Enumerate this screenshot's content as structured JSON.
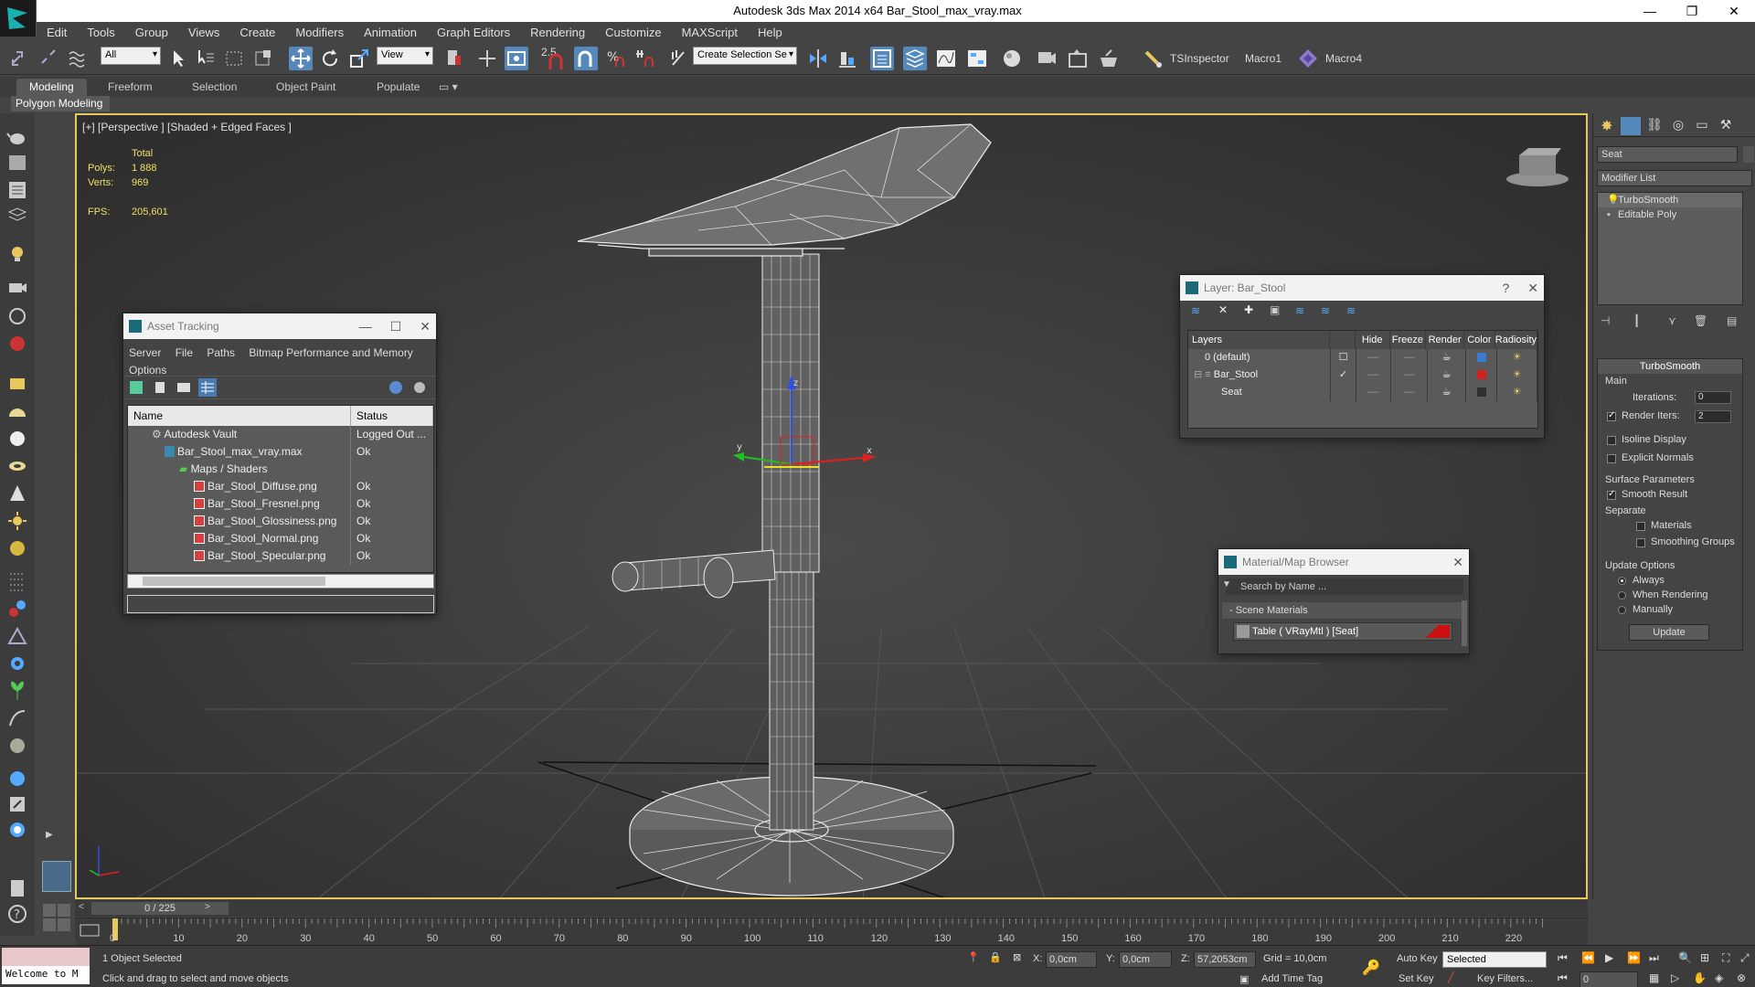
{
  "window": {
    "title": "Autodesk 3ds Max  2014 x64     Bar_Stool_max_vray.max"
  },
  "menu": [
    "Edit",
    "Tools",
    "Group",
    "Views",
    "Create",
    "Modifiers",
    "Animation",
    "Graph Editors",
    "Rendering",
    "Customize",
    "MAXScript",
    "Help"
  ],
  "toolbar": {
    "filter": "All",
    "refcoord": "View",
    "snap_value": "2.5",
    "selection_set": "Create Selection Se",
    "ts_inspector": "TSInspector",
    "macro1": "Macro1",
    "macro4": "Macro4"
  },
  "ribbon": {
    "tabs": [
      "Modeling",
      "Freeform",
      "Selection",
      "Object Paint",
      "Populate"
    ],
    "panel": "Polygon Modeling"
  },
  "viewport": {
    "label": "[+] [Perspective ] [Shaded + Edged Faces ]",
    "stats": {
      "total_label": "Total",
      "polys_label": "Polys:",
      "polys": "1 888",
      "verts_label": "Verts:",
      "verts": "969",
      "fps_label": "FPS:",
      "fps": "205,601"
    },
    "axes": {
      "x": "x",
      "y": "y",
      "z": "z"
    }
  },
  "asset_tracking": {
    "title": "Asset Tracking",
    "menus": [
      "Server",
      "File",
      "Paths",
      "Bitmap Performance and Memory",
      "Options"
    ],
    "columns": [
      "Name",
      "Status"
    ],
    "rows": [
      {
        "name": "Autodesk Vault",
        "status": "Logged Out ..."
      },
      {
        "name": "Bar_Stool_max_vray.max",
        "status": "Ok"
      },
      {
        "name": "Maps / Shaders",
        "status": ""
      },
      {
        "name": "Bar_Stool_Diffuse.png",
        "status": "Ok"
      },
      {
        "name": "Bar_Stool_Fresnel.png",
        "status": "Ok"
      },
      {
        "name": "Bar_Stool_Glossiness.png",
        "status": "Ok"
      },
      {
        "name": "Bar_Stool_Normal.png",
        "status": "Ok"
      },
      {
        "name": "Bar_Stool_Specular.png",
        "status": "Ok"
      }
    ]
  },
  "layer_window": {
    "title": "Layer: Bar_Stool",
    "help": "?",
    "columns": [
      "Layers",
      "Hide",
      "Freeze",
      "Render",
      "Color",
      "Radiosity"
    ],
    "rows": [
      {
        "name": "0 (default)",
        "color": "#3a7ad0"
      },
      {
        "name": "Bar_Stool",
        "color": "#d02020"
      },
      {
        "name": "Seat",
        "color": "#303030"
      }
    ]
  },
  "material_browser": {
    "title": "Material/Map Browser",
    "search": "Search by Name ...",
    "section": "- Scene Materials",
    "item": "Table ( VRayMtl ) [Seat]"
  },
  "command_panel": {
    "object_name": "Seat",
    "modifier_list": "Modifier List",
    "stack": [
      "TurboSmooth",
      "Editable Poly"
    ],
    "turbosmooth": {
      "title": "TurboSmooth",
      "main": "Main",
      "iterations_label": "Iterations:",
      "iterations": "0",
      "render_iters_label": "Render Iters:",
      "render_iters": "2",
      "isoline": "Isoline Display",
      "explicit_normals": "Explicit Normals",
      "surface_params": "Surface Parameters",
      "smooth_result": "Smooth Result",
      "separate": "Separate",
      "materials": "Materials",
      "smoothing_groups": "Smoothing Groups",
      "update_options": "Update Options",
      "always": "Always",
      "when_rendering": "When Rendering",
      "manually": "Manually",
      "update": "Update"
    }
  },
  "timeline": {
    "frame": "0 / 225",
    "ticks": [
      "0",
      "10",
      "20",
      "30",
      "40",
      "50",
      "60",
      "70",
      "80",
      "90",
      "100",
      "110",
      "120",
      "130",
      "140",
      "150",
      "160",
      "170",
      "180",
      "190",
      "200",
      "210",
      "220"
    ]
  },
  "status": {
    "welcome": "Welcome to M",
    "selected": "1 Object Selected",
    "prompt": "Click and drag to select and move objects",
    "x_label": "X:",
    "x": "0,0cm",
    "y_label": "Y:",
    "y": "0,0cm",
    "z_label": "Z:",
    "z": "57,2053cm",
    "grid": "Grid = 10,0cm",
    "add_time_tag": "Add Time Tag",
    "auto_key": "Auto Key",
    "set_key": "Set Key",
    "selected_set": "Selected",
    "key_filters": "Key Filters...",
    "frame_value": "0"
  }
}
